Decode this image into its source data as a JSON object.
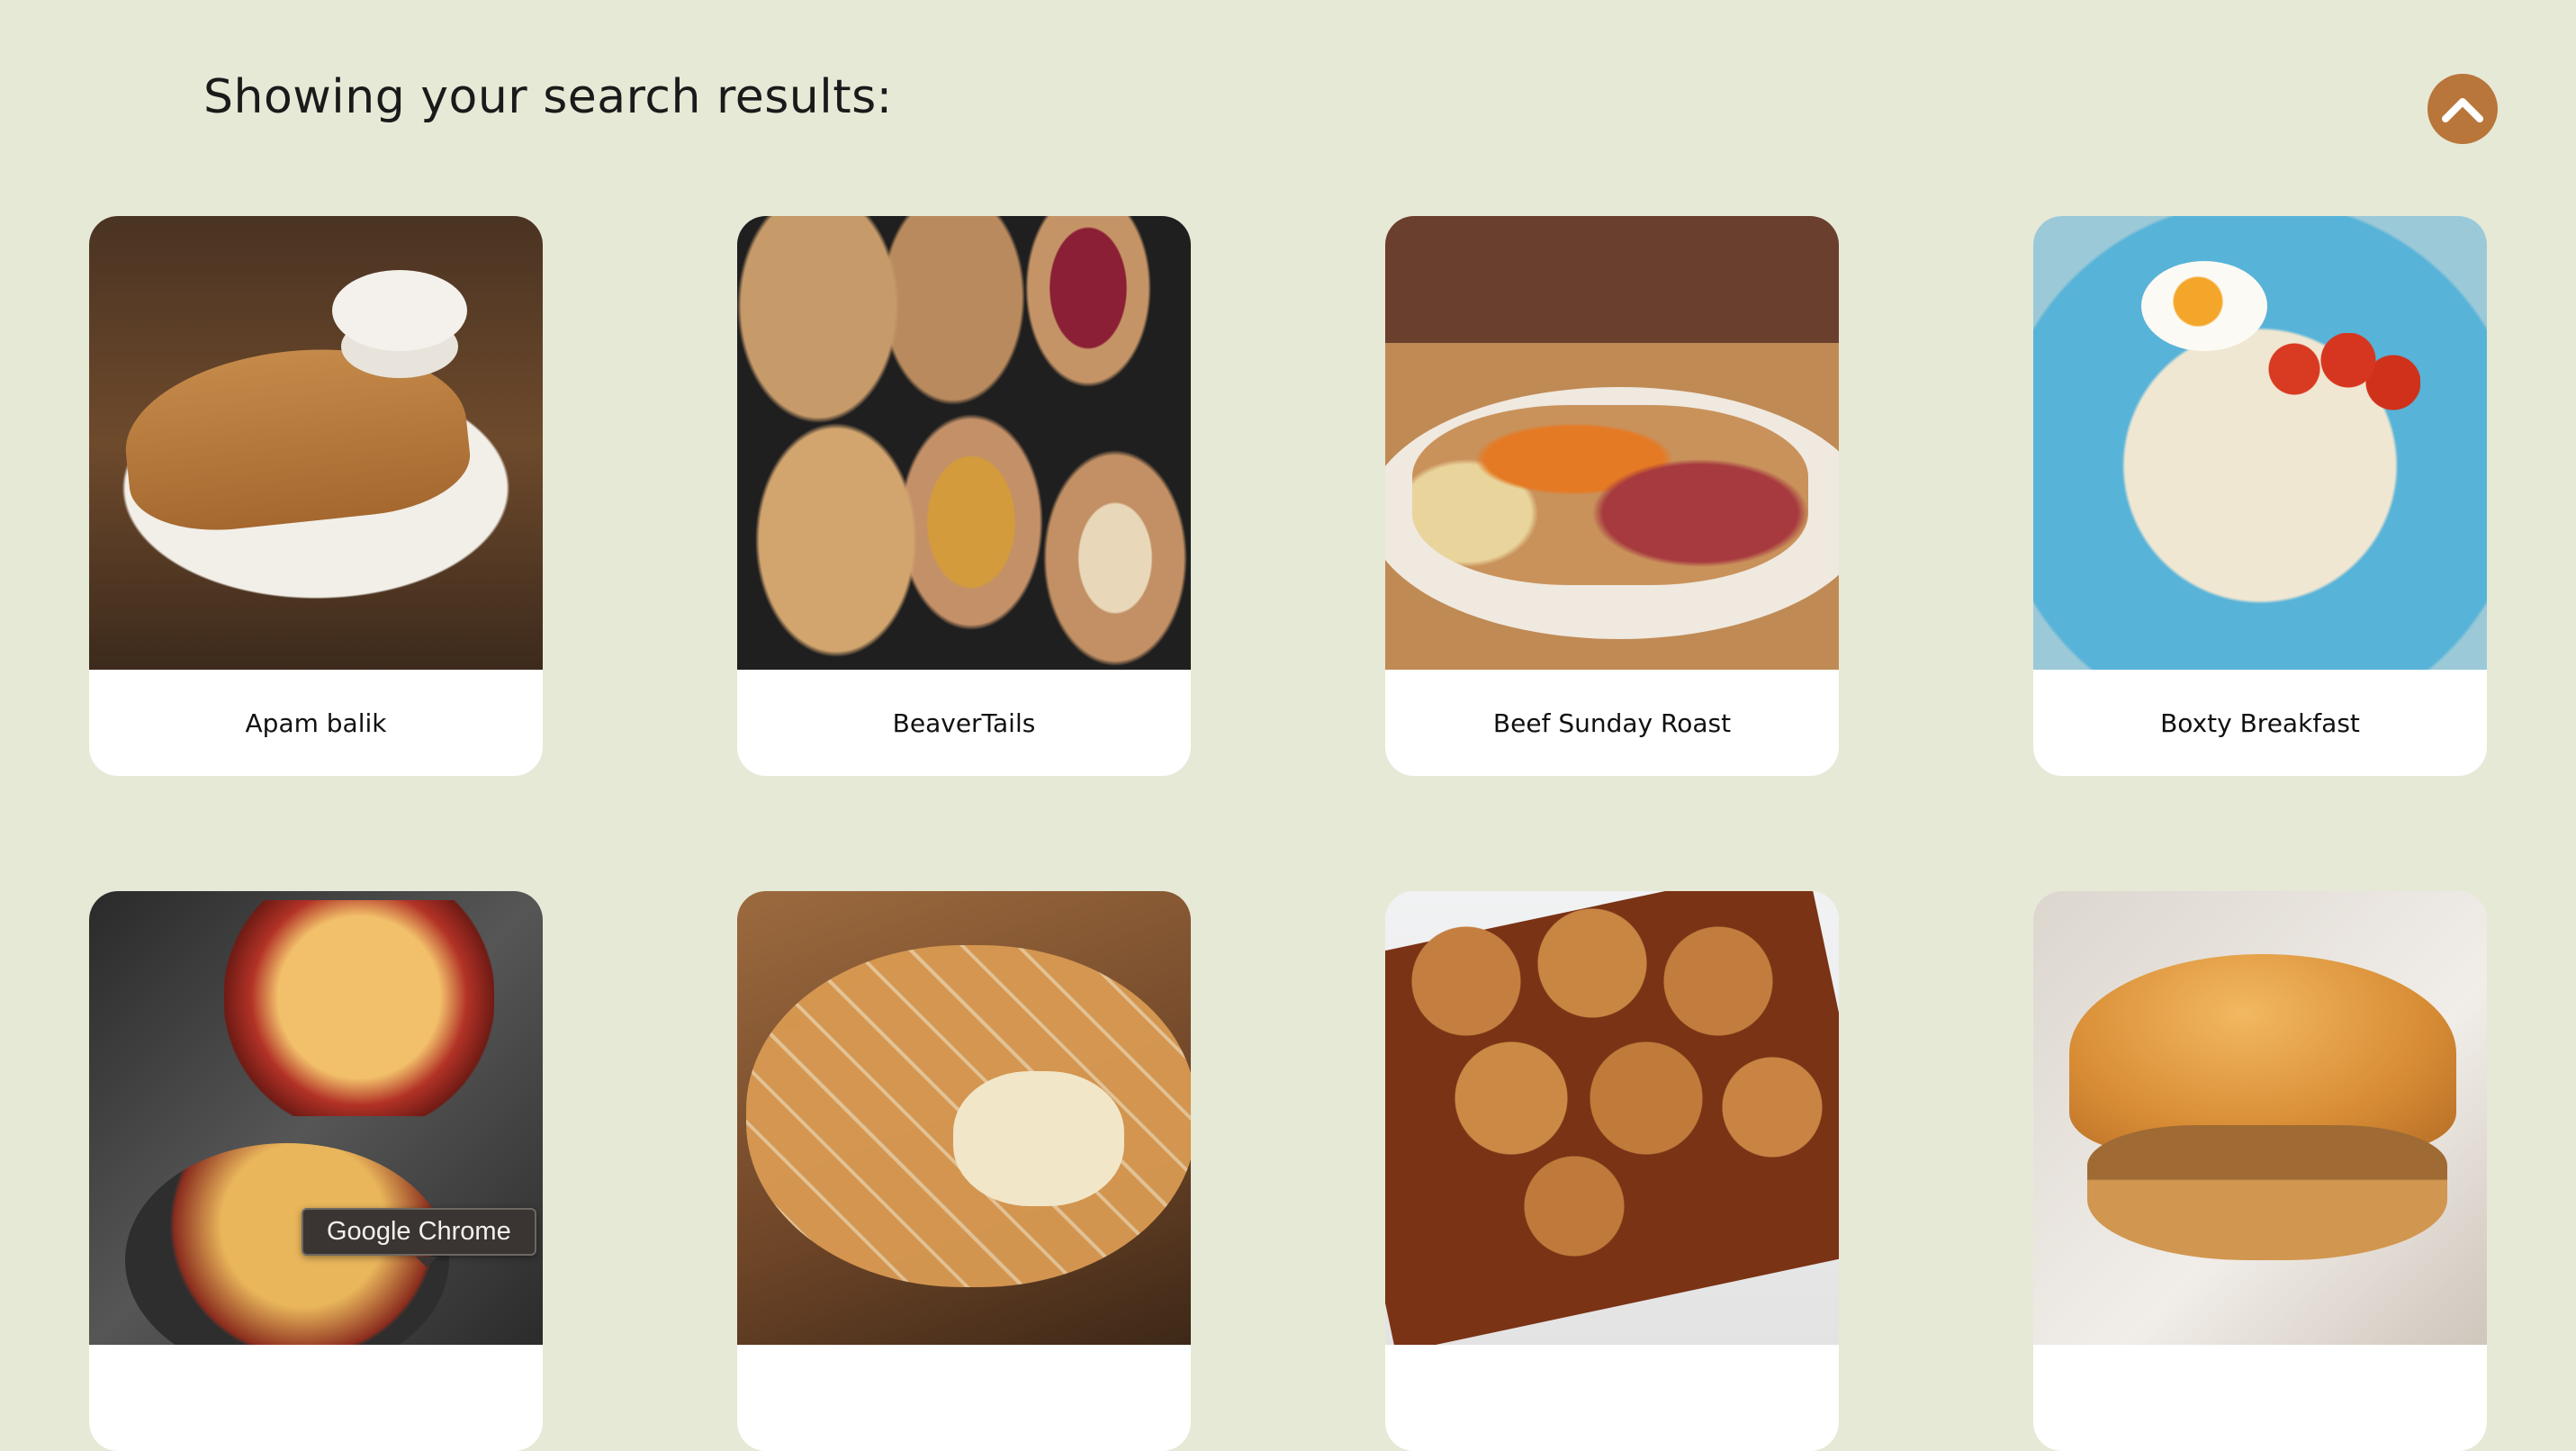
{
  "page": {
    "heading": "Showing your search results:"
  },
  "scroll_top_button": {
    "icon": "chevron-up-icon",
    "color": "#b8763b"
  },
  "results": [
    {
      "name": "Apam balik"
    },
    {
      "name": "BeaverTails"
    },
    {
      "name": "Beef Sunday Roast"
    },
    {
      "name": "Boxty Breakfast"
    },
    {
      "name": ""
    },
    {
      "name": ""
    },
    {
      "name": ""
    },
    {
      "name": ""
    }
  ],
  "tooltip": {
    "text": "Google Chrome"
  },
  "colors": {
    "background": "#e6e9d6",
    "card": "#ffffff",
    "accent": "#b8763b"
  }
}
